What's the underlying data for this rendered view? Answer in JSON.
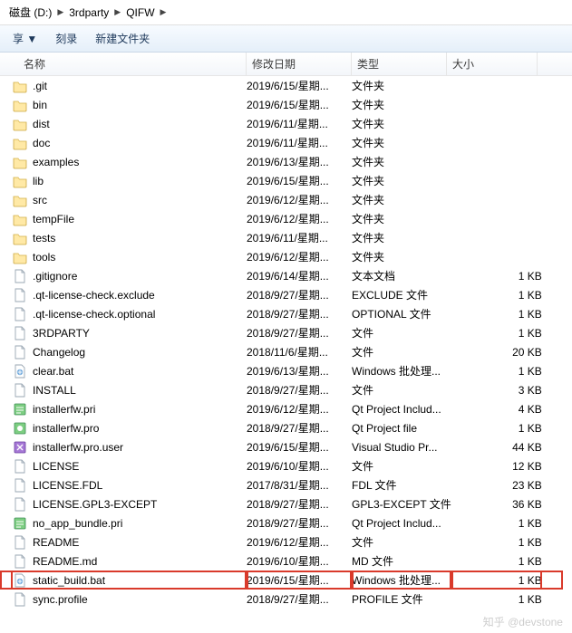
{
  "breadcrumb": [
    {
      "label": "磁盘 (D:)"
    },
    {
      "label": "3rdparty"
    },
    {
      "label": "QIFW"
    }
  ],
  "toolbar": {
    "share": "享 ▼",
    "burn": "刻录",
    "newFolder": "新建文件夹"
  },
  "columns": {
    "name": "名称",
    "date": "修改日期",
    "type": "类型",
    "size": "大小"
  },
  "watermark": "知乎 @devstone",
  "rows": [
    {
      "icon": "folder",
      "name": ".git",
      "date": "2019/6/15/星期...",
      "type": "文件夹",
      "size": ""
    },
    {
      "icon": "folder",
      "name": "bin",
      "date": "2019/6/15/星期...",
      "type": "文件夹",
      "size": ""
    },
    {
      "icon": "folder",
      "name": "dist",
      "date": "2019/6/11/星期...",
      "type": "文件夹",
      "size": ""
    },
    {
      "icon": "folder",
      "name": "doc",
      "date": "2019/6/11/星期...",
      "type": "文件夹",
      "size": ""
    },
    {
      "icon": "folder",
      "name": "examples",
      "date": "2019/6/13/星期...",
      "type": "文件夹",
      "size": ""
    },
    {
      "icon": "folder",
      "name": "lib",
      "date": "2019/6/15/星期...",
      "type": "文件夹",
      "size": ""
    },
    {
      "icon": "folder",
      "name": "src",
      "date": "2019/6/12/星期...",
      "type": "文件夹",
      "size": ""
    },
    {
      "icon": "folder",
      "name": "tempFile",
      "date": "2019/6/12/星期...",
      "type": "文件夹",
      "size": ""
    },
    {
      "icon": "folder",
      "name": "tests",
      "date": "2019/6/11/星期...",
      "type": "文件夹",
      "size": ""
    },
    {
      "icon": "folder",
      "name": "tools",
      "date": "2019/6/12/星期...",
      "type": "文件夹",
      "size": ""
    },
    {
      "icon": "file",
      "name": ".gitignore",
      "date": "2019/6/14/星期...",
      "type": "文本文档",
      "size": "1 KB"
    },
    {
      "icon": "file",
      "name": ".qt-license-check.exclude",
      "date": "2018/9/27/星期...",
      "type": "EXCLUDE 文件",
      "size": "1 KB"
    },
    {
      "icon": "file",
      "name": ".qt-license-check.optional",
      "date": "2018/9/27/星期...",
      "type": "OPTIONAL 文件",
      "size": "1 KB"
    },
    {
      "icon": "file",
      "name": "3RDPARTY",
      "date": "2018/9/27/星期...",
      "type": "文件",
      "size": "1 KB"
    },
    {
      "icon": "file",
      "name": "Changelog",
      "date": "2018/11/6/星期...",
      "type": "文件",
      "size": "20 KB"
    },
    {
      "icon": "bat",
      "name": "clear.bat",
      "date": "2019/6/13/星期...",
      "type": "Windows 批处理...",
      "size": "1 KB"
    },
    {
      "icon": "file",
      "name": "INSTALL",
      "date": "2018/9/27/星期...",
      "type": "文件",
      "size": "3 KB"
    },
    {
      "icon": "pri",
      "name": "installerfw.pri",
      "date": "2019/6/12/星期...",
      "type": "Qt Project Includ...",
      "size": "4 KB"
    },
    {
      "icon": "pro",
      "name": "installerfw.pro",
      "date": "2018/9/27/星期...",
      "type": "Qt Project file",
      "size": "1 KB"
    },
    {
      "icon": "vs",
      "name": "installerfw.pro.user",
      "date": "2019/6/15/星期...",
      "type": "Visual Studio Pr...",
      "size": "44 KB"
    },
    {
      "icon": "file",
      "name": "LICENSE",
      "date": "2019/6/10/星期...",
      "type": "文件",
      "size": "12 KB"
    },
    {
      "icon": "file",
      "name": "LICENSE.FDL",
      "date": "2017/8/31/星期...",
      "type": "FDL 文件",
      "size": "23 KB"
    },
    {
      "icon": "file",
      "name": "LICENSE.GPL3-EXCEPT",
      "date": "2018/9/27/星期...",
      "type": "GPL3-EXCEPT 文件",
      "size": "36 KB"
    },
    {
      "icon": "pri",
      "name": "no_app_bundle.pri",
      "date": "2018/9/27/星期...",
      "type": "Qt Project Includ...",
      "size": "1 KB"
    },
    {
      "icon": "file",
      "name": "README",
      "date": "2019/6/12/星期...",
      "type": "文件",
      "size": "1 KB"
    },
    {
      "icon": "file",
      "name": "README.md",
      "date": "2019/6/10/星期...",
      "type": "MD 文件",
      "size": "1 KB"
    },
    {
      "icon": "bat",
      "name": "static_build.bat",
      "date": "2019/6/15/星期...",
      "type": "Windows 批处理...",
      "size": "1 KB",
      "hl": true
    },
    {
      "icon": "file",
      "name": "sync.profile",
      "date": "2018/9/27/星期...",
      "type": "PROFILE 文件",
      "size": "1 KB"
    }
  ]
}
